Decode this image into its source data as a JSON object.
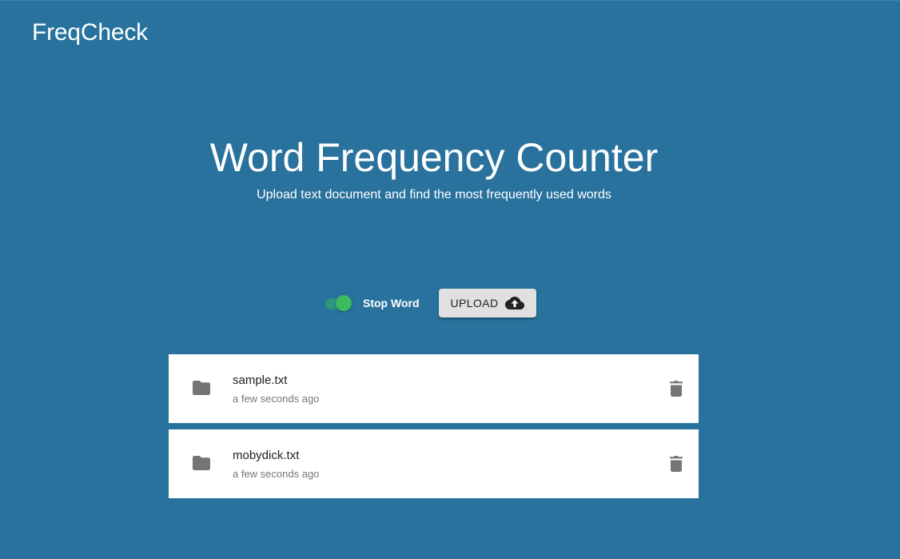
{
  "app": {
    "brand": "FreqCheck"
  },
  "hero": {
    "title": "Word Frequency Counter",
    "subtitle": "Upload text document and find the most frequently used words"
  },
  "controls": {
    "stop_word_toggle": {
      "label": "Stop Word",
      "checked": true
    },
    "upload_button": {
      "label": "UPLOAD",
      "icon": "cloud-upload-icon"
    }
  },
  "files": [
    {
      "name": "sample.txt",
      "time": "a few seconds ago",
      "icon": "folder-icon",
      "action_icon": "trash-icon"
    },
    {
      "name": "mobydick.txt",
      "time": "a few seconds ago",
      "icon": "folder-icon",
      "action_icon": "trash-icon"
    }
  ],
  "colors": {
    "background": "#28729d",
    "toggle_on": "#3cbb61",
    "button_bg": "#e0e0e0",
    "card_bg": "#ffffff",
    "icon_gray": "#757575"
  }
}
